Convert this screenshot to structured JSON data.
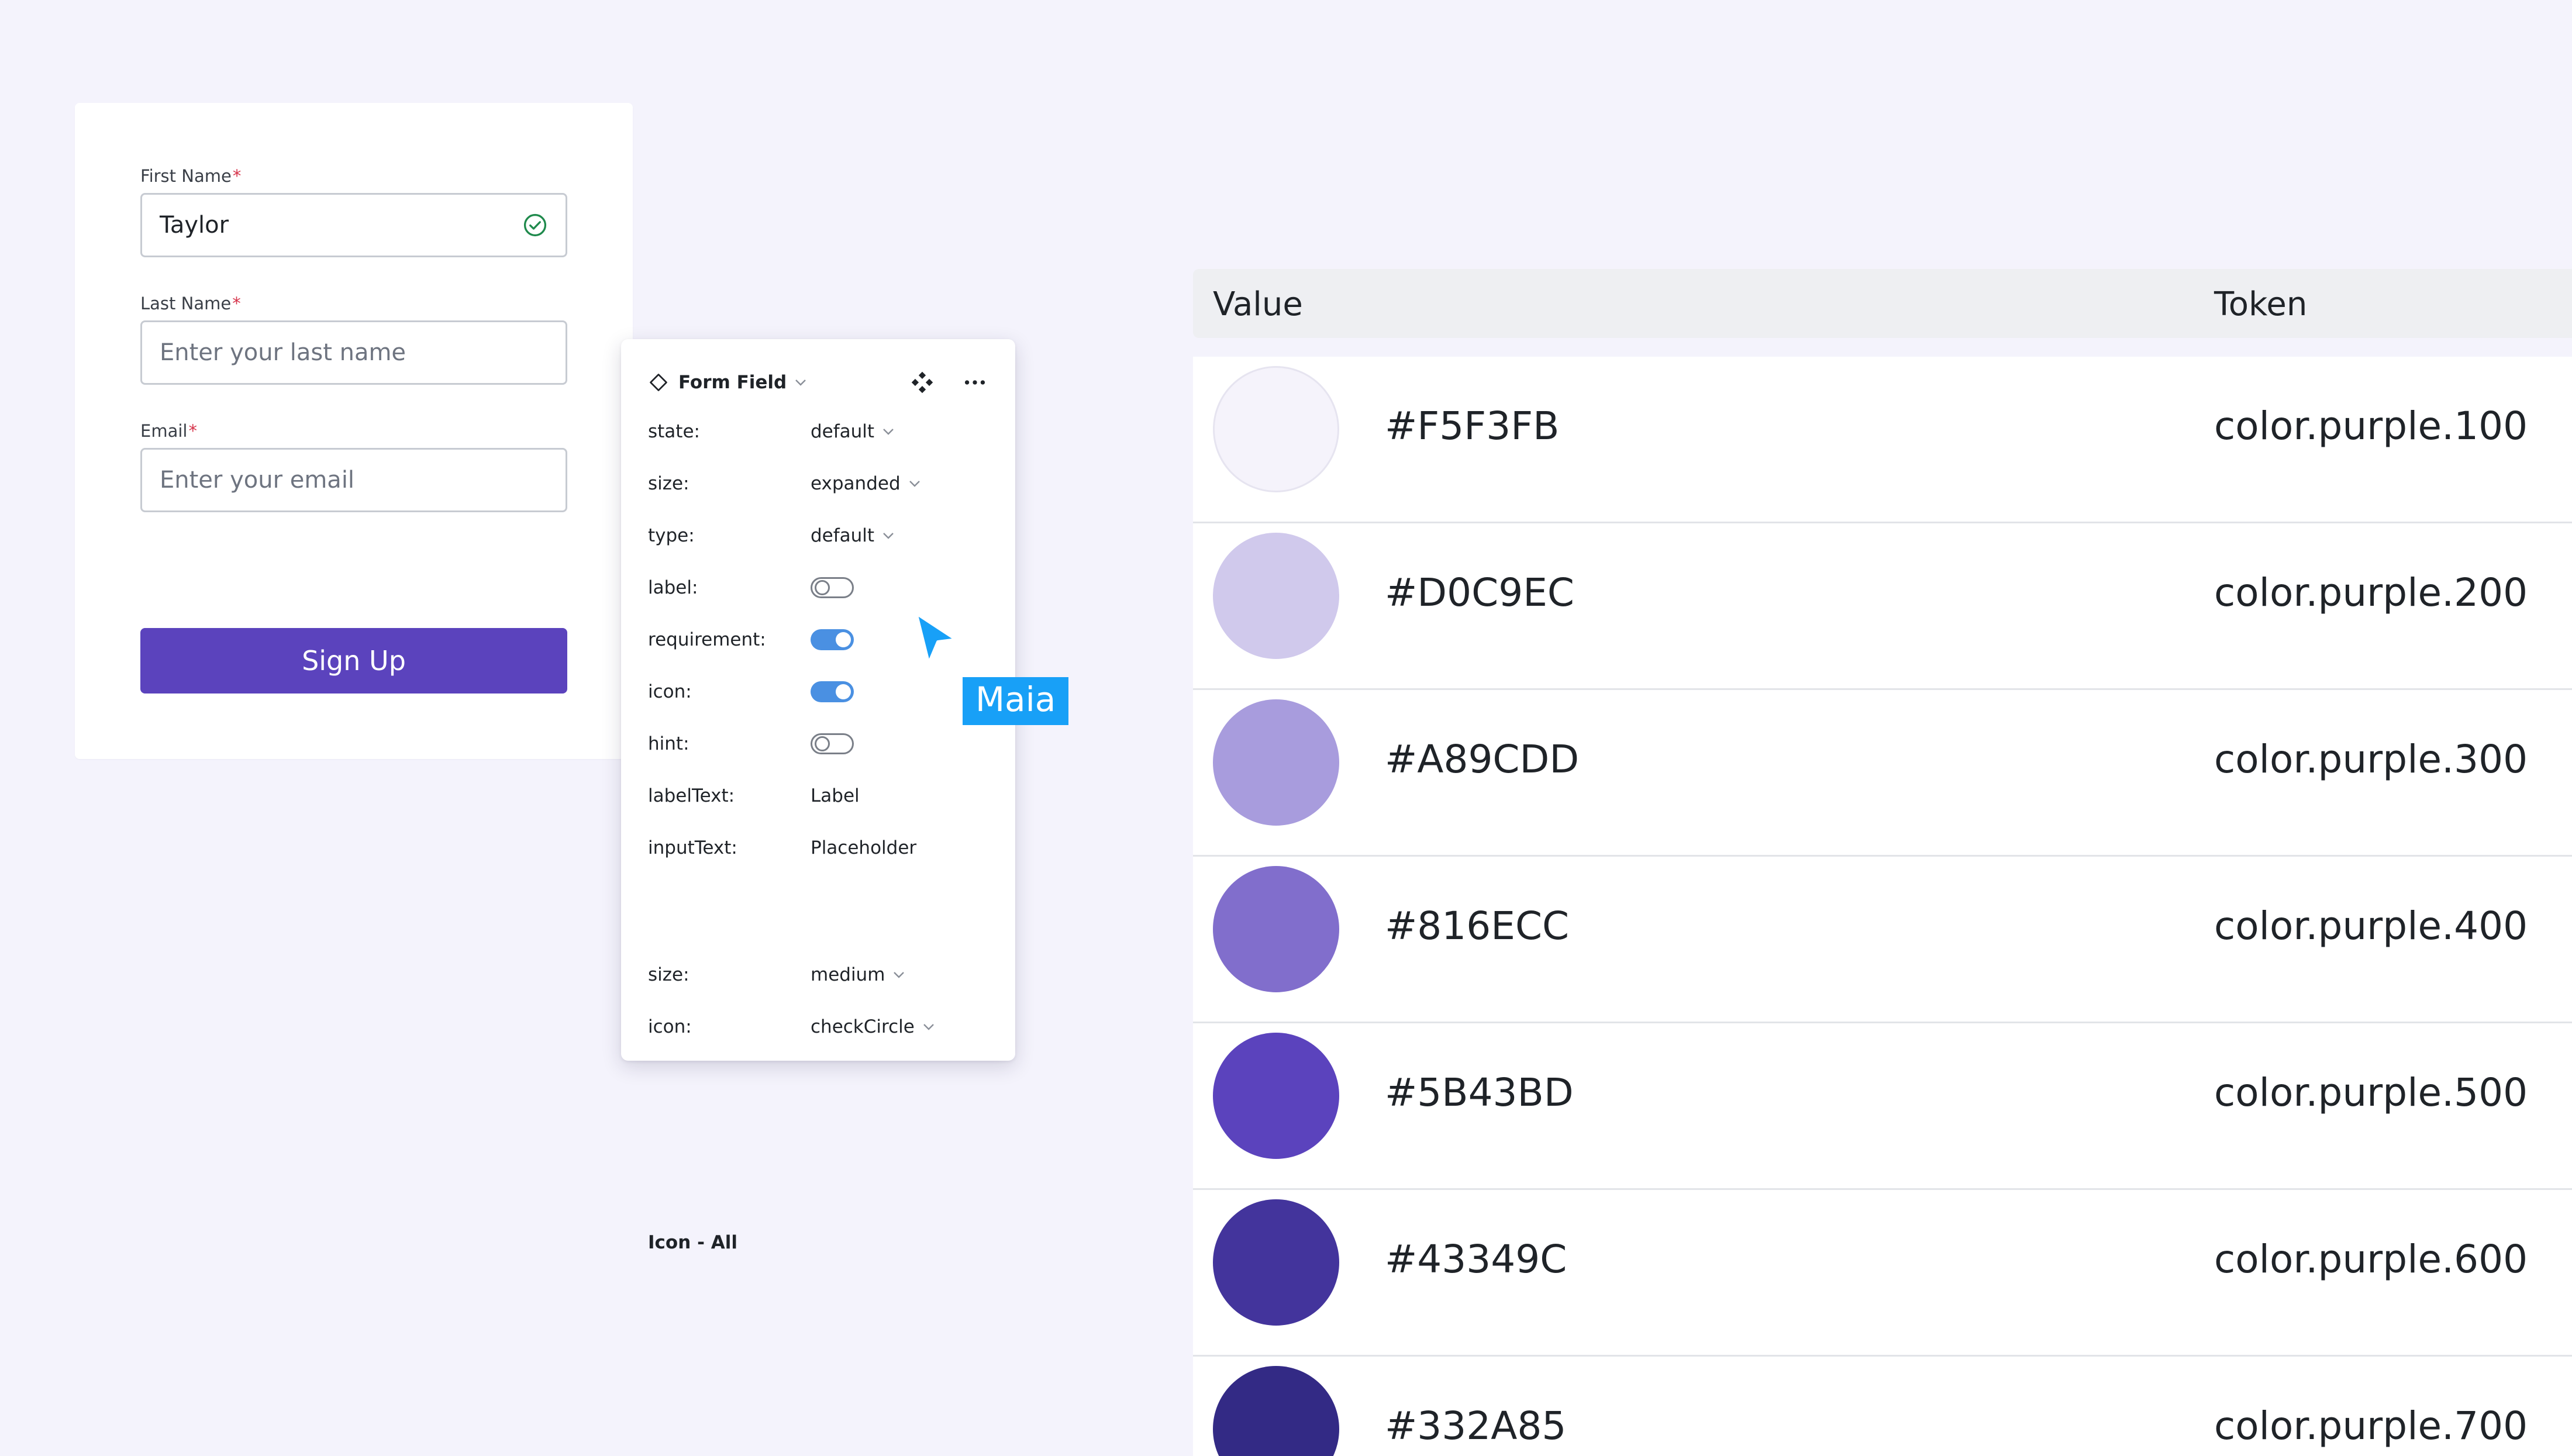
{
  "form": {
    "first_name": {
      "label": "First Name",
      "required_mark": "*",
      "value": "Taylor",
      "state_icon": "check-circle-icon"
    },
    "last_name": {
      "label": "Last Name",
      "required_mark": "*",
      "placeholder": "Enter your last name"
    },
    "email": {
      "label": "Email",
      "required_mark": "*",
      "placeholder": "Enter your email"
    },
    "submit_label": "Sign Up",
    "accent": "#5B43BD"
  },
  "panel": {
    "component_icon": "diamond-icon",
    "title": "Form Field",
    "properties": [
      {
        "key": "state:",
        "kind": "dropdown",
        "value": "default"
      },
      {
        "key": "size:",
        "kind": "dropdown",
        "value": "expanded"
      },
      {
        "key": "type:",
        "kind": "dropdown",
        "value": "default"
      },
      {
        "key": "label:",
        "kind": "toggle",
        "on": false
      },
      {
        "key": "requirement:",
        "kind": "toggle",
        "on": true
      },
      {
        "key": "icon:",
        "kind": "toggle",
        "on": true
      },
      {
        "key": "hint:",
        "kind": "toggle",
        "on": false
      },
      {
        "key": "labelText:",
        "kind": "text",
        "value": "Label"
      },
      {
        "key": "inputText:",
        "kind": "text",
        "value": "Placeholder"
      }
    ],
    "icon_section": {
      "title": "Icon - All",
      "properties": [
        {
          "key": "size:",
          "kind": "dropdown",
          "value": "medium"
        },
        {
          "key": "icon:",
          "kind": "dropdown",
          "value": "checkCircle"
        }
      ]
    }
  },
  "cursor": {
    "name": "Maia",
    "color": "#18A0F7"
  },
  "color_table": {
    "headers": {
      "value": "Value",
      "token": "Token"
    },
    "rows": [
      {
        "hex": "#F5F3FB",
        "token": "color.purple.100",
        "color": "#F5F3FB"
      },
      {
        "hex": "#D0C9EC",
        "token": "color.purple.200",
        "color": "#D0C9EC"
      },
      {
        "hex": "#A89CDD",
        "token": "color.purple.300",
        "color": "#A89CDD"
      },
      {
        "hex": "#816ECC",
        "token": "color.purple.400",
        "color": "#816ECC"
      },
      {
        "hex": "#5B43BD",
        "token": "color.purple.500",
        "color": "#5B43BD"
      },
      {
        "hex": "#43349C",
        "token": "color.purple.600",
        "color": "#43349C"
      },
      {
        "hex": "#332A85",
        "token": "color.purple.700",
        "color": "#332A85"
      }
    ]
  }
}
